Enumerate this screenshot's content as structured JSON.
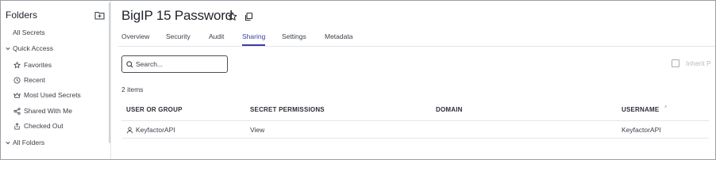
{
  "sidebar": {
    "title": "Folders",
    "add_folder_icon": "folder-plus-icon",
    "items": [
      {
        "label": "All Secrets",
        "icon": ""
      },
      {
        "label": "Quick Access",
        "icon": "chevron-down-icon"
      },
      {
        "label": "Favorites",
        "icon": "star-icon"
      },
      {
        "label": "Recent",
        "icon": "clock-icon"
      },
      {
        "label": "Most Used Secrets",
        "icon": "crown-icon"
      },
      {
        "label": "Shared With Me",
        "icon": "share-icon"
      },
      {
        "label": "Checked Out",
        "icon": "checkout-icon"
      },
      {
        "label": "All Folders",
        "icon": "chevron-down-icon"
      }
    ]
  },
  "header": {
    "title": "BigIP 15 Password",
    "favorite_icon": "star-icon",
    "copy_icon": "copy-icon"
  },
  "tabs": [
    "Overview",
    "Security",
    "Audit",
    "Sharing",
    "Settings",
    "Metadata"
  ],
  "active_tab": "Sharing",
  "search": {
    "placeholder": "Search...",
    "value": ""
  },
  "inherit": {
    "label": "Inherit P",
    "checked": false
  },
  "count_label": "2 items",
  "table": {
    "columns": [
      "USER OR GROUP",
      "SECRET PERMISSIONS",
      "DOMAIN",
      "USERNAME"
    ],
    "sort_indicator": "˄",
    "rows": [
      {
        "user_or_group": "KeyfactorAPI",
        "secret_permissions": "View",
        "domain": "",
        "username": "KeyfactorAPI"
      }
    ]
  },
  "colors": {
    "accent": "#3b3ea0",
    "text": "#2b2f36",
    "border": "#e3e5e8"
  }
}
